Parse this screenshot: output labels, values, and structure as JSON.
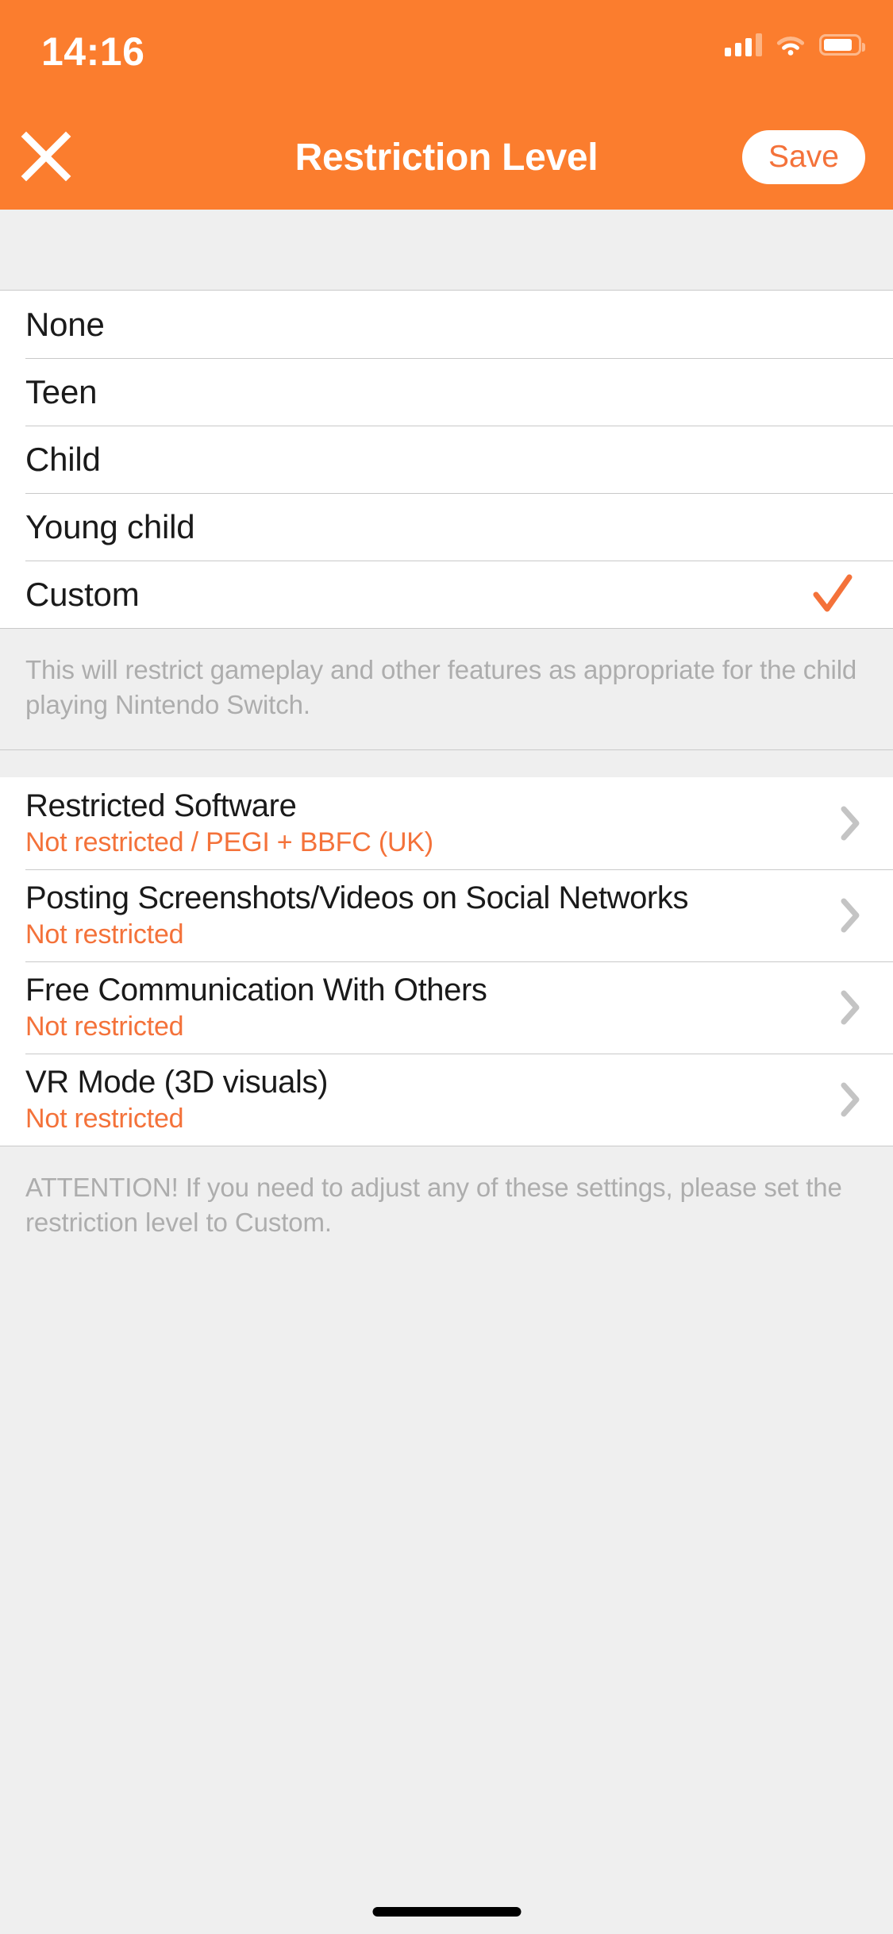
{
  "theme": {
    "accent": "#fb7d2e",
    "accent_text": "#f4723a",
    "page_bg": "#efefef",
    "card_bg": "#ffffff",
    "separator": "#c9c9c9",
    "muted_text": "#adadad",
    "primary_text": "#1a1a1a",
    "chevron": "#c4c4c4"
  },
  "status_bar": {
    "time": "14:16",
    "cellular_icon": "cellular-bars-icon",
    "wifi_icon": "wifi-icon",
    "battery_icon": "battery-icon"
  },
  "navbar": {
    "close_icon": "close-icon",
    "title": "Restriction Level",
    "save_label": "Save"
  },
  "restriction_levels": {
    "options": [
      {
        "label": "None",
        "selected": false
      },
      {
        "label": "Teen",
        "selected": false
      },
      {
        "label": "Child",
        "selected": false
      },
      {
        "label": "Young child",
        "selected": false
      },
      {
        "label": "Custom",
        "selected": true
      }
    ],
    "checkmark_icon": "checkmark-icon",
    "footnote": "This will restrict gameplay and other features as appropriate for the child playing Nintendo Switch."
  },
  "settings": {
    "rows": [
      {
        "title": "Restricted Software",
        "value": "Not restricted / PEGI + BBFC (UK)",
        "chevron_icon": "chevron-right-icon"
      },
      {
        "title": "Posting Screenshots/Videos on Social Networks",
        "value": "Not restricted",
        "chevron_icon": "chevron-right-icon"
      },
      {
        "title": "Free Communication With Others",
        "value": "Not restricted",
        "chevron_icon": "chevron-right-icon"
      },
      {
        "title": "VR Mode (3D visuals)",
        "value": "Not restricted",
        "chevron_icon": "chevron-right-icon"
      }
    ],
    "footnote": "ATTENTION! If you need to adjust any of these settings, please set the restriction level to Custom."
  },
  "home_indicator": "home-indicator"
}
